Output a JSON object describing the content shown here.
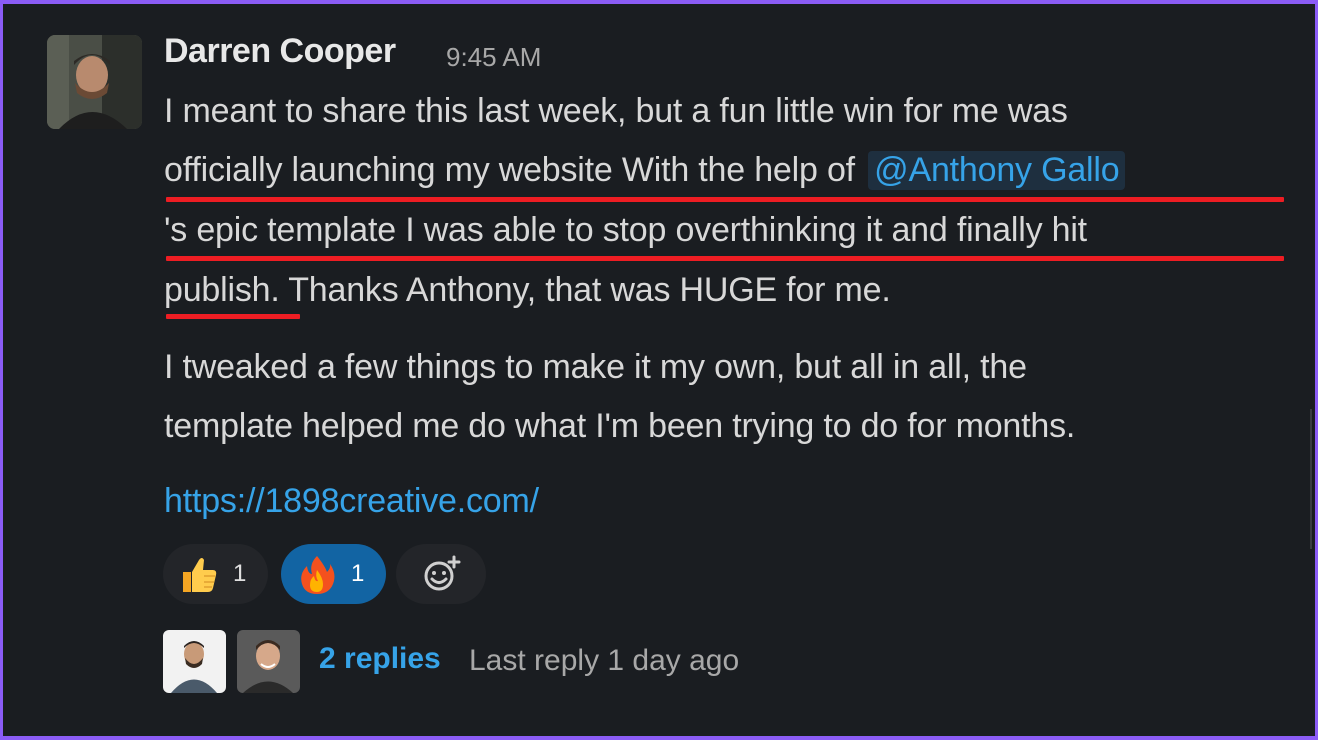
{
  "message": {
    "sender": "Darren Cooper",
    "timestamp": "9:45 AM",
    "paragraph1": {
      "line1": "I meant to share this last week, but a fun little win for me was",
      "line2_text": "officially launching my website With the help of",
      "mention": "@Anthony Gallo",
      "line3": "'s epic template I was able to stop overthinking it and finally hit",
      "line4": "publish. Thanks Anthony, that was HUGE for me."
    },
    "paragraph2": {
      "line1": "I tweaked a few things to make it my own, but all in all, the",
      "line2": "template helped me do what I'm been trying to do for months."
    },
    "link": "https://1898creative.com/"
  },
  "reactions": [
    {
      "emoji": "thumbs-up",
      "count": "1",
      "active": false
    },
    {
      "emoji": "fire",
      "count": "1",
      "active": true
    }
  ],
  "thread": {
    "replies_label": "2 replies",
    "last_reply": "Last reply 1 day ago"
  },
  "colors": {
    "background": "#1a1d21",
    "frame": "#8b5cf6",
    "link": "#36a3e8",
    "highlight": "#ee1d23",
    "active_reaction": "#1264a3"
  }
}
